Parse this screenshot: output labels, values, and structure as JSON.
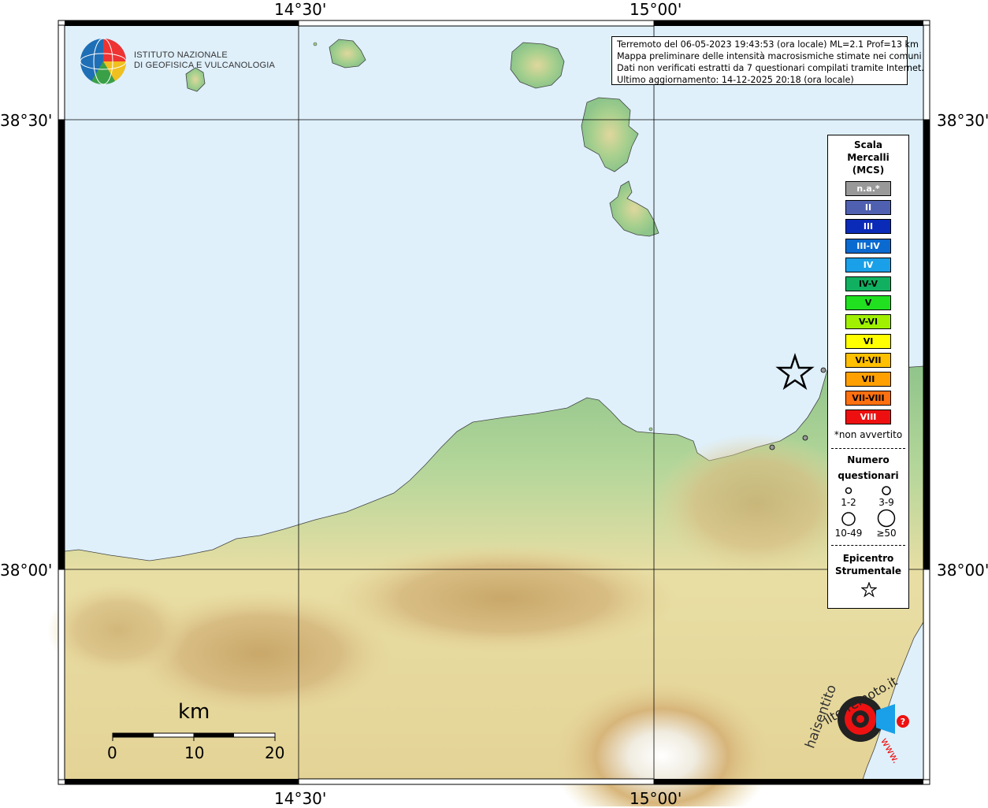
{
  "map": {
    "coords": {
      "top_left": "14°30'",
      "top_right": "15°00'",
      "bottom_left": "14°30'",
      "bottom_right": "15°00'",
      "left_top": "38°30'",
      "left_bottom": "38°00'",
      "right_top": "38°30'",
      "right_bottom": "38°00'"
    },
    "colors": {
      "sea": "#dff0fb",
      "lowland": "#9ccc8c",
      "hill": "#e6d9a0",
      "mountain": "#c9a86a",
      "peak": "#ffffff",
      "grid": "#000000"
    }
  },
  "logo": {
    "line1": "ISTITUTO NAZIONALE",
    "line2": "DI GEOFISICA E VULCANOLOGIA"
  },
  "info": {
    "line1": "Terremoto del 06-05-2023 19:43:53 (ora locale) ML=2.1 Prof=13 km",
    "line2": "Mappa preliminare delle intensità macrosismiche stimate nei comuni",
    "line3": "Dati non verificati estratti da 7 questionari compilati tramite Internet.",
    "line4": "Ultimo aggiornamento: 14-12-2025 20:18 (ora locale)"
  },
  "legend": {
    "title1": "Scala",
    "title2": "Mercalli",
    "title3": "(MCS)",
    "classes": [
      {
        "label": "n.a.*",
        "color": "#999999",
        "text": "#ffffff"
      },
      {
        "label": "II",
        "color": "#5060b0",
        "text": "#ffffff"
      },
      {
        "label": "III",
        "color": "#0a2ab8",
        "text": "#ffffff"
      },
      {
        "label": "III-IV",
        "color": "#0a6ad0",
        "text": "#ffffff"
      },
      {
        "label": "IV",
        "color": "#1aa0e8",
        "text": "#ffffff"
      },
      {
        "label": "IV-V",
        "color": "#10b060",
        "text": "#000000"
      },
      {
        "label": "V",
        "color": "#20e020",
        "text": "#000000"
      },
      {
        "label": "V-VI",
        "color": "#a0f000",
        "text": "#000000"
      },
      {
        "label": "VI",
        "color": "#ffff00",
        "text": "#000000"
      },
      {
        "label": "VI-VII",
        "color": "#ffc000",
        "text": "#000000"
      },
      {
        "label": "VII",
        "color": "#ffa000",
        "text": "#000000"
      },
      {
        "label": "VII-VIII",
        "color": "#ff7010",
        "text": "#000000"
      },
      {
        "label": "VIII",
        "color": "#ee1010",
        "text": "#ffffff"
      }
    ],
    "not_felt_note": "*non avvertito",
    "count_title1": "Numero",
    "count_title2": "questionari",
    "counts": [
      "1-2",
      "3-9",
      "10-49",
      "≥50"
    ],
    "epicenter_title1": "Epicentro",
    "epicenter_title2": "Strumentale"
  },
  "scalebar": {
    "unit": "km",
    "ticks": [
      "0",
      "10",
      "20"
    ]
  },
  "watermark": {
    "left_text": "haisentito",
    "mid_text": "ilterremoto.it",
    "bottom_text": "www."
  }
}
